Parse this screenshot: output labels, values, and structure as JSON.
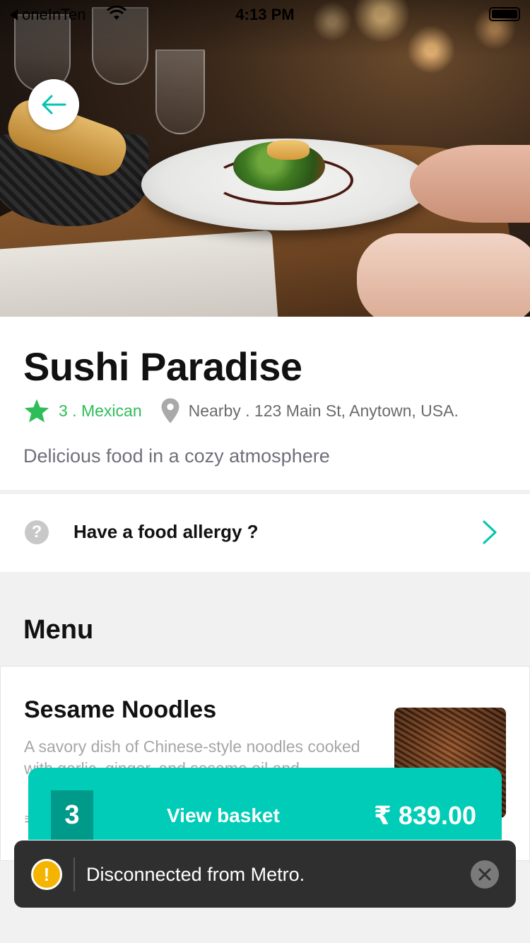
{
  "status_bar": {
    "back_app": "oneInTen",
    "time": "4:13 PM"
  },
  "restaurant": {
    "name": "Sushi Paradise",
    "rating_cuisine": "3 . Mexican",
    "address": "Nearby . 123 Main St, Anytown, USA.",
    "description": "Delicious food in a cozy atmosphere"
  },
  "allergy": {
    "label": "Have a food allergy ?",
    "icon": "question-icon"
  },
  "menu": {
    "heading": "Menu",
    "items": [
      {
        "name": "Sesame Noodles",
        "description": "A savory dish of Chinese-style noodles cooked with garlic, ginger, and sesame oil and",
        "price": "₹"
      }
    ]
  },
  "basket": {
    "count": "3",
    "label": "View basket",
    "total": "₹ 839.00"
  },
  "toast": {
    "message": "Disconnected from Metro."
  },
  "colors": {
    "accent": "#00ccb8",
    "rating_green": "#2ebd59",
    "toast_bg": "#2f2f2f"
  }
}
